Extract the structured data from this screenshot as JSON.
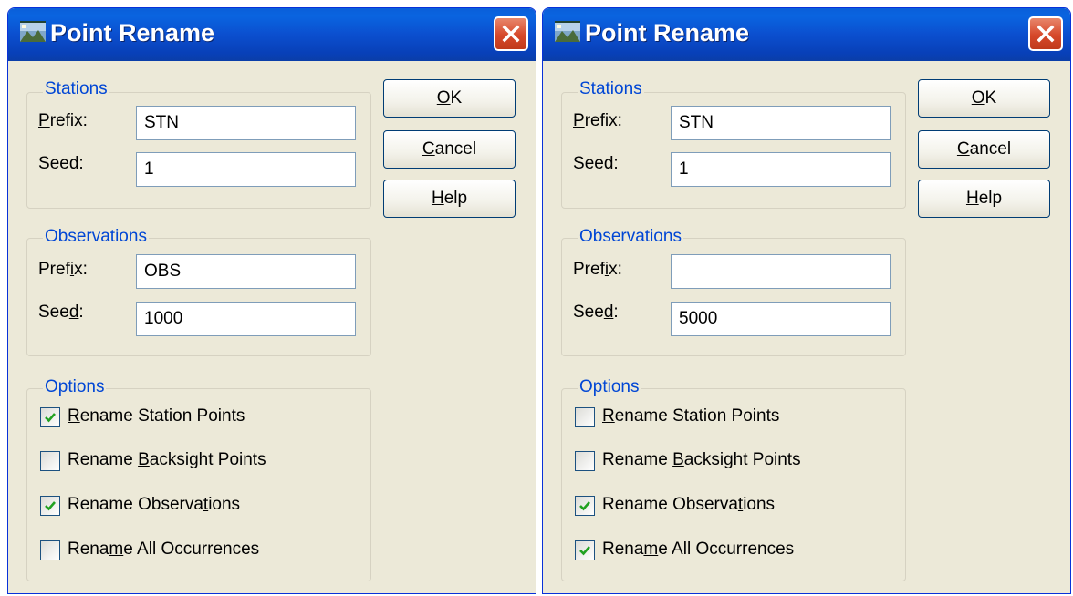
{
  "dialogs": [
    {
      "title": "Point Rename",
      "stations": {
        "label": "Stations",
        "prefix_label": "Prefix:",
        "prefix_value": "STN",
        "seed_label": "Seed:",
        "seed_value": "1"
      },
      "observations": {
        "label": "Observations",
        "prefix_label": "Prefix:",
        "prefix_value": "OBS",
        "seed_label": "Seed:",
        "seed_value": "1000"
      },
      "options": {
        "label": "Options",
        "items": [
          {
            "label": "Rename Station Points",
            "checked": true
          },
          {
            "label": "Rename Backsight Points",
            "checked": false
          },
          {
            "label": "Rename Observations",
            "checked": true
          },
          {
            "label": "Rename All Occurrences",
            "checked": false
          }
        ]
      },
      "buttons": {
        "ok": "OK",
        "cancel": "Cancel",
        "help": "Help"
      }
    },
    {
      "title": "Point Rename",
      "stations": {
        "label": "Stations",
        "prefix_label": "Prefix:",
        "prefix_value": "STN",
        "seed_label": "Seed:",
        "seed_value": "1"
      },
      "observations": {
        "label": "Observations",
        "prefix_label": "Prefix:",
        "prefix_value": "",
        "seed_label": "Seed:",
        "seed_value": "5000"
      },
      "options": {
        "label": "Options",
        "items": [
          {
            "label": "Rename Station Points",
            "checked": false
          },
          {
            "label": "Rename Backsight Points",
            "checked": false
          },
          {
            "label": "Rename Observations",
            "checked": true
          },
          {
            "label": "Rename All Occurrences",
            "checked": true
          }
        ]
      },
      "buttons": {
        "ok": "OK",
        "cancel": "Cancel",
        "help": "Help"
      }
    }
  ],
  "colors": {
    "titlebar": "#0b4fcf",
    "dialog_bg": "#ece9d8",
    "group_label": "#0046d5",
    "close_button": "#d6482a",
    "checkmark": "#21a121"
  },
  "icons": {
    "app": "app-icon",
    "close": "close-icon",
    "check": "checkmark-icon"
  }
}
